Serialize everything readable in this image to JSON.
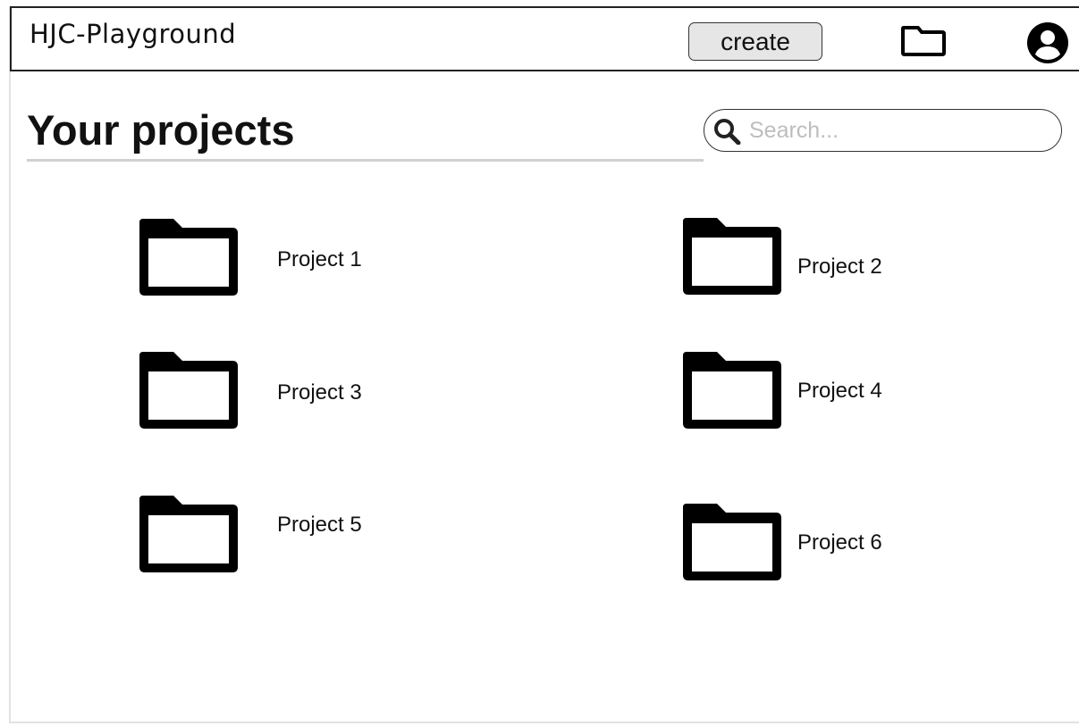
{
  "header": {
    "app_title": "HJC-Playground",
    "create_label": "create",
    "folder_icon": "folder-icon",
    "user_icon": "user-circle-icon"
  },
  "main": {
    "title": "Your projects",
    "search": {
      "placeholder": "Search...",
      "value": "",
      "icon": "search-icon"
    }
  },
  "projects": [
    {
      "label": "Project 1",
      "icon": "folder-icon"
    },
    {
      "label": "Project 2",
      "icon": "folder-icon"
    },
    {
      "label": "Project 3",
      "icon": "folder-icon"
    },
    {
      "label": "Project 4",
      "icon": "folder-icon"
    },
    {
      "label": "Project 5",
      "icon": "folder-icon"
    },
    {
      "label": "Project 6",
      "icon": "folder-icon"
    }
  ],
  "colors": {
    "icon": "#000000",
    "button_bg": "#e6e6e6",
    "placeholder": "#bdbdbd"
  }
}
